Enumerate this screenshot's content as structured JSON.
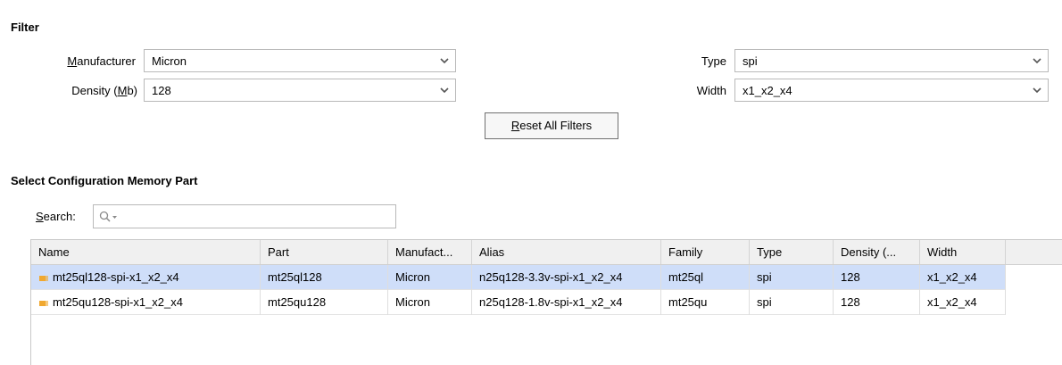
{
  "filter": {
    "section_title": "Filter",
    "manufacturer": {
      "label_accel": "M",
      "label_rest": "anufacturer",
      "value": "Micron"
    },
    "density": {
      "label_pre": "Density (",
      "label_accel": "M",
      "label_post": "b)",
      "value": "128"
    },
    "type": {
      "label": "Type",
      "value": "spi"
    },
    "width": {
      "label": "Width",
      "value": "x1_x2_x4"
    },
    "reset": {
      "accel": "R",
      "rest": "eset All Filters"
    }
  },
  "select": {
    "section_title": "Select Configuration Memory Part",
    "search_label_accel": "S",
    "search_label_rest": "earch:",
    "search_value": ""
  },
  "table": {
    "columns": [
      "Name",
      "Part",
      "Manufact...",
      "Alias",
      "Family",
      "Type",
      "Density (...",
      "Width"
    ],
    "rows": [
      {
        "name": "mt25ql128-spi-x1_x2_x4",
        "part": "mt25ql128",
        "manufacturer": "Micron",
        "alias": "n25q128-3.3v-spi-x1_x2_x4",
        "family": "mt25ql",
        "type": "spi",
        "density": "128",
        "width": "x1_x2_x4",
        "selected": true
      },
      {
        "name": "mt25qu128-spi-x1_x2_x4",
        "part": "mt25qu128",
        "manufacturer": "Micron",
        "alias": "n25q128-1.8v-spi-x1_x2_x4",
        "family": "mt25qu",
        "type": "spi",
        "density": "128",
        "width": "x1_x2_x4",
        "selected": false
      }
    ]
  },
  "icons": {
    "chip": "memory-chip-icon",
    "search": "search-icon",
    "dropdown": "chevron-down-icon"
  },
  "colors": {
    "selection": "#cfdef9",
    "header": "#f0f0f0",
    "chip_icon": "#f0a830"
  }
}
